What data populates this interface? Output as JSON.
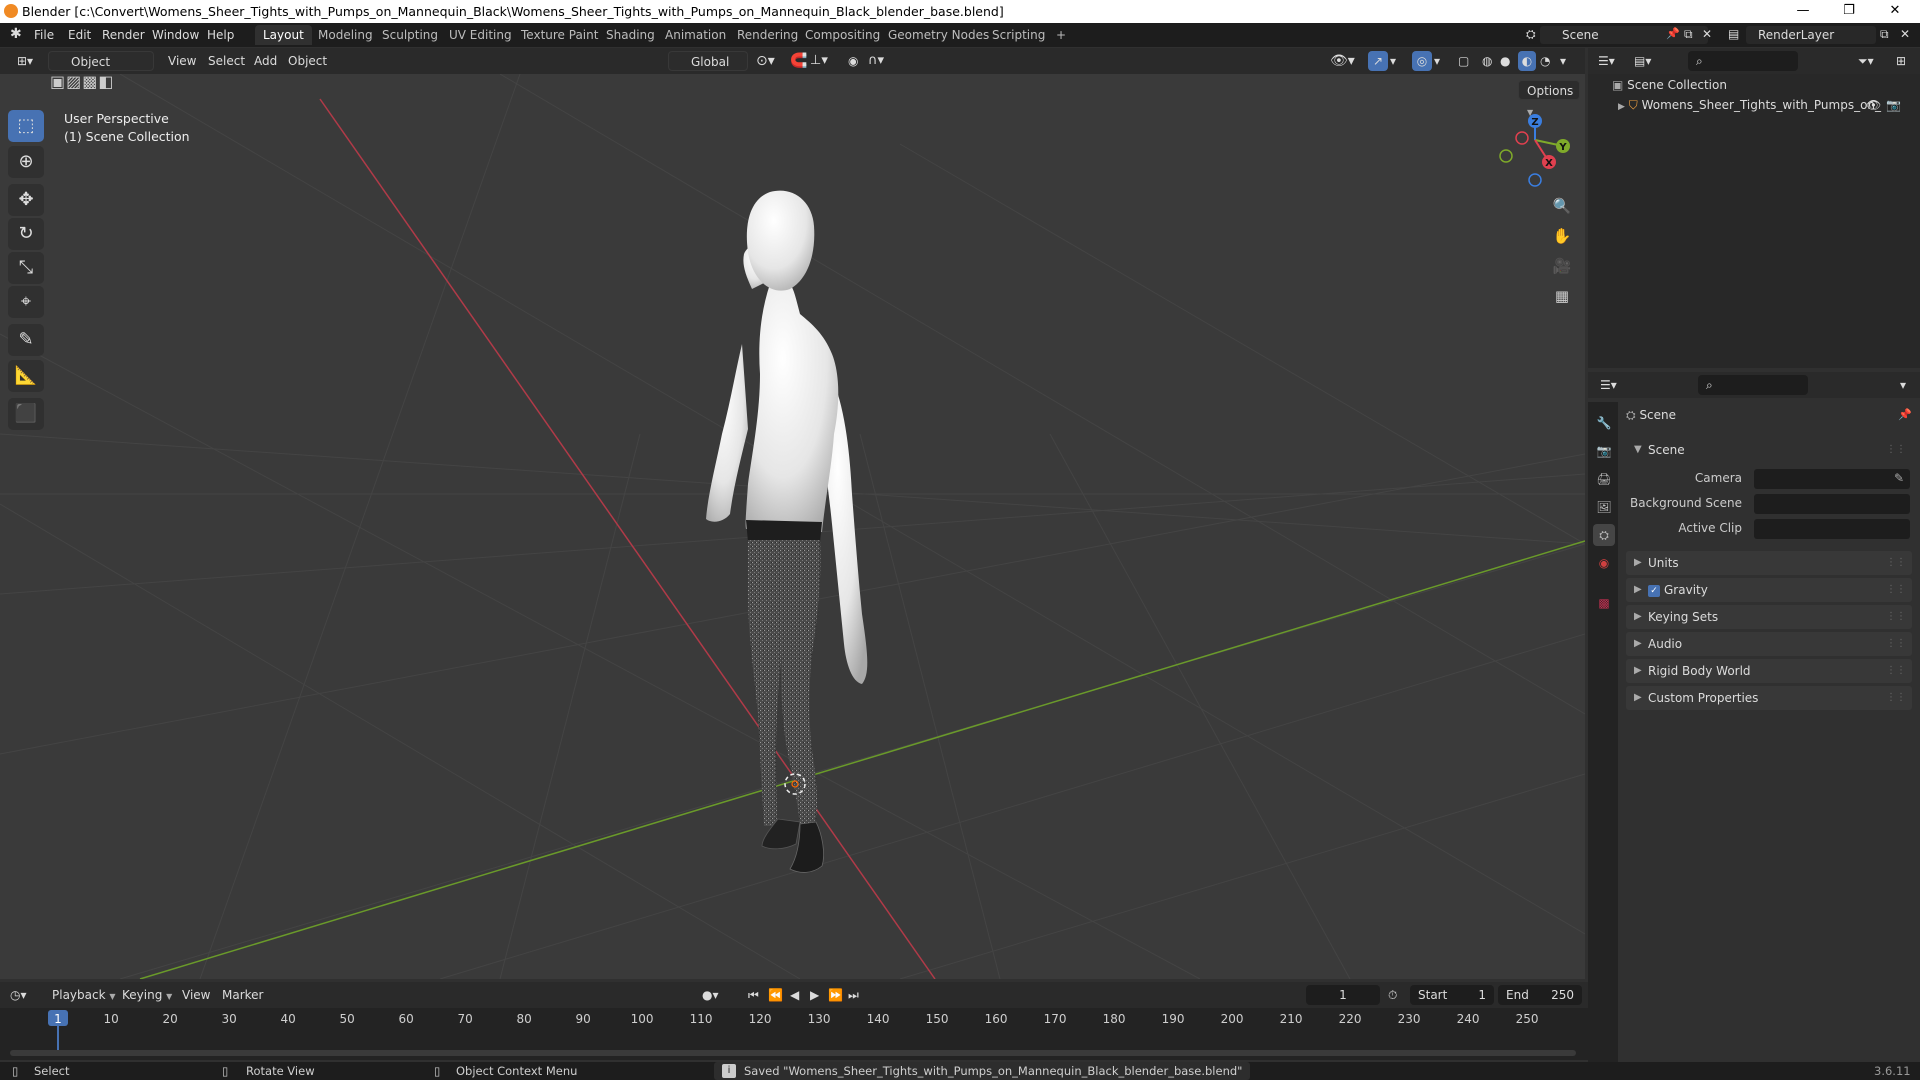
{
  "window": {
    "title": "Blender [c:\\Convert\\Womens_Sheer_Tights_with_Pumps_on_Mannequin_Black\\Womens_Sheer_Tights_with_Pumps_on_Mannequin_Black_blender_base.blend]",
    "minimize": "—",
    "maximize": "❐",
    "close": "✕"
  },
  "menu": [
    "File",
    "Edit",
    "Render",
    "Window",
    "Help"
  ],
  "workspaces": [
    "Layout",
    "Modeling",
    "Sculpting",
    "UV Editing",
    "Texture Paint",
    "Shading",
    "Animation",
    "Rendering",
    "Compositing",
    "Geometry Nodes",
    "Scripting",
    "+"
  ],
  "active_workspace": "Layout",
  "scene_selector": {
    "value": "Scene"
  },
  "view_layer": {
    "value": "RenderLayer"
  },
  "viewport_header": {
    "mode": "Object Mode",
    "menus": [
      "View",
      "Select",
      "Add",
      "Object"
    ],
    "transform": "Global",
    "options": "Options"
  },
  "viewport": {
    "info_line1": "User Perspective",
    "info_line2": "(1) Scene Collection",
    "axis_x": "X",
    "axis_y": "Y",
    "axis_z": "Z"
  },
  "outliner": {
    "root": "Scene Collection",
    "items": [
      {
        "label": "Womens_Sheer_Tights_with_Pumps_on_"
      }
    ]
  },
  "properties": {
    "title": "Scene",
    "section": "Scene",
    "rows": [
      {
        "label": "Camera",
        "value": ""
      },
      {
        "label": "Background Scene",
        "value": ""
      },
      {
        "label": "Active Clip",
        "value": ""
      }
    ],
    "panels": [
      "Units",
      "Gravity",
      "Keying Sets",
      "Audio",
      "Rigid Body World",
      "Custom Properties"
    ]
  },
  "timeline": {
    "menus": [
      "Playback",
      "Keying",
      "View",
      "Marker"
    ],
    "current_frame": "1",
    "start_label": "Start",
    "start": "1",
    "end_label": "End",
    "end": "250",
    "ruler": [
      "1",
      "10",
      "20",
      "30",
      "40",
      "50",
      "60",
      "70",
      "80",
      "90",
      "100",
      "110",
      "120",
      "130",
      "140",
      "150",
      "160",
      "170",
      "180",
      "190",
      "200",
      "210",
      "220",
      "230",
      "240",
      "250"
    ]
  },
  "statusbar": {
    "select": "Select",
    "rotate": "Rotate View",
    "context": "Object Context Menu",
    "message": "Saved \"Womens_Sheer_Tights_with_Pumps_on_Mannequin_Black_blender_base.blend\"",
    "version": "3.6.11"
  },
  "colors": {
    "accent": "#4772b3",
    "x_axis": "#e0404f",
    "y_axis": "#7faa2a",
    "z_axis": "#3a7ee0"
  }
}
